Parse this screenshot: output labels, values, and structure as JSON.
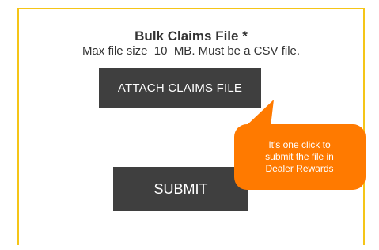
{
  "form": {
    "title": "Bulk Claims File *",
    "subtitle": "Max file size  10  MB. Must be a CSV file.",
    "attach_label": "ATTACH CLAIMS FILE",
    "submit_label": "SUBMIT"
  },
  "callout": {
    "lines": [
      "It's one click to",
      "submit the file in",
      "Dealer Rewards"
    ]
  },
  "colors": {
    "border": "#f5c518",
    "button": "#3f3f3f",
    "callout": "#ff7a00"
  }
}
